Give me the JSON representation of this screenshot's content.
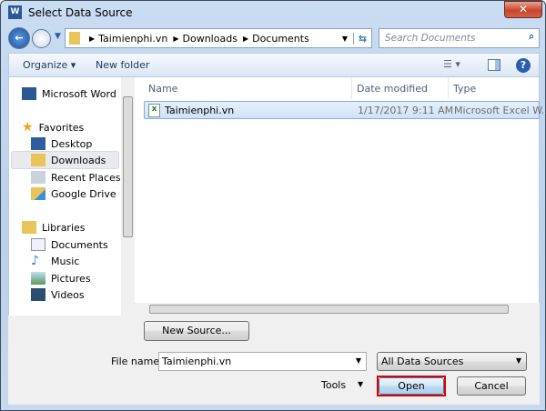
{
  "window": {
    "title": "Select Data Source",
    "close": "✕"
  },
  "address": {
    "crumbs": [
      "Taimienphi.vn",
      "Downloads",
      "Documents"
    ],
    "search_placeholder": "Search Documents"
  },
  "toolbar": {
    "organize": "Organize ▾",
    "new_folder": "New folder"
  },
  "nav": {
    "top": "Microsoft Word",
    "favorites": "Favorites",
    "fav_items": [
      "Desktop",
      "Downloads",
      "Recent Places",
      "Google Drive"
    ],
    "libraries": "Libraries",
    "lib_items": [
      "Documents",
      "Music",
      "Pictures",
      "Videos"
    ]
  },
  "columns": [
    "Name",
    "Date modified",
    "Type"
  ],
  "files": [
    {
      "name": "Taimienphi.vn",
      "date": "1/17/2017 9:11 AM",
      "type": "Microsoft Excel W..."
    }
  ],
  "bottom": {
    "new_source": "New Source...",
    "file_name_label": "File name:",
    "file_name_value": "Taimienphi.vn",
    "filter": "All Data Sources",
    "tools": "Tools",
    "open": "Open",
    "cancel": "Cancel"
  }
}
